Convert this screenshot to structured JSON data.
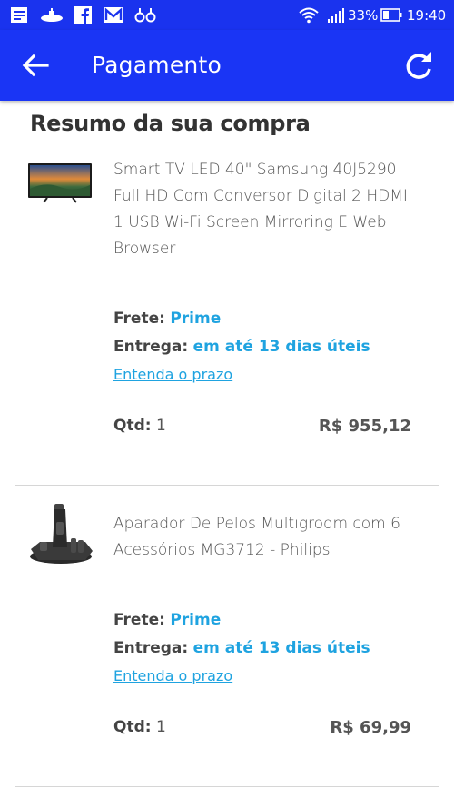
{
  "status_bar": {
    "battery": "33%",
    "time": "19:40"
  },
  "app_bar": {
    "title": "Pagamento",
    "back_icon": "arrow-left-icon",
    "refresh_icon": "refresh-icon"
  },
  "summary": {
    "title": "Resumo da sua compra"
  },
  "items": [
    {
      "name": "Smart TV LED 40\" Samsung 40J5290 Full HD Com Conversor Digital 2 HDMI 1 USB Wi-Fi Screen Mirroring E Web Browser",
      "frete_label": "Frete:",
      "frete_value": "Prime",
      "entrega_label": "Entrega:",
      "entrega_value": "em até 13 dias úteis",
      "prazo_link": "Entenda o prazo",
      "qtd_label": "Qtd:",
      "qtd_value": "1",
      "price": "R$ 955,12",
      "thumb_icon": "tv-product-icon"
    },
    {
      "name": "Aparador De Pelos Multigroom com 6 Acessórios MG3712 - Philips",
      "frete_label": "Frete:",
      "frete_value": "Prime",
      "entrega_label": "Entrega:",
      "entrega_value": "em até 13 dias úteis",
      "prazo_link": "Entenda o prazo",
      "qtd_label": "Qtd:",
      "qtd_value": "1",
      "price": "R$ 69,99",
      "thumb_icon": "trimmer-product-icon"
    }
  ],
  "colors": {
    "app_bar": "#1a35f5",
    "status_bar": "#1a33ee",
    "accent": "#1fa3e0"
  }
}
